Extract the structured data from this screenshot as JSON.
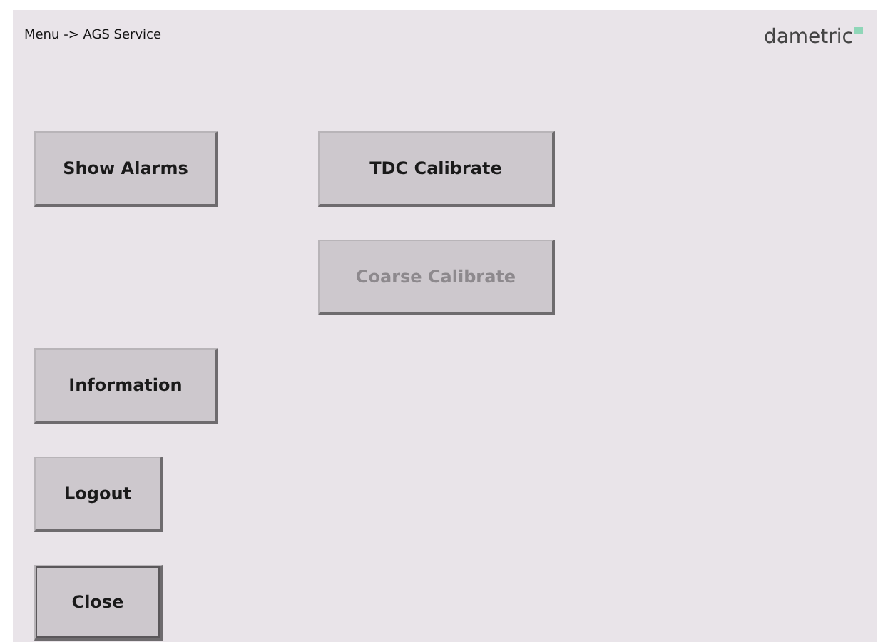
{
  "header": {
    "breadcrumb": "Menu -> AGS Service",
    "logo": "dametric"
  },
  "left_buttons": [
    {
      "label": "Show Alarms",
      "disabled": false,
      "focused": false
    },
    {
      "label": "Information",
      "disabled": false,
      "focused": false
    },
    {
      "label": "Logout",
      "disabled": false,
      "focused": false
    },
    {
      "label": "Close",
      "disabled": false,
      "focused": true
    }
  ],
  "right_buttons": [
    {
      "label": "TDC Calibrate",
      "disabled": false,
      "focused": false
    },
    {
      "label": "Coarse Calibrate",
      "disabled": true,
      "focused": false
    }
  ]
}
